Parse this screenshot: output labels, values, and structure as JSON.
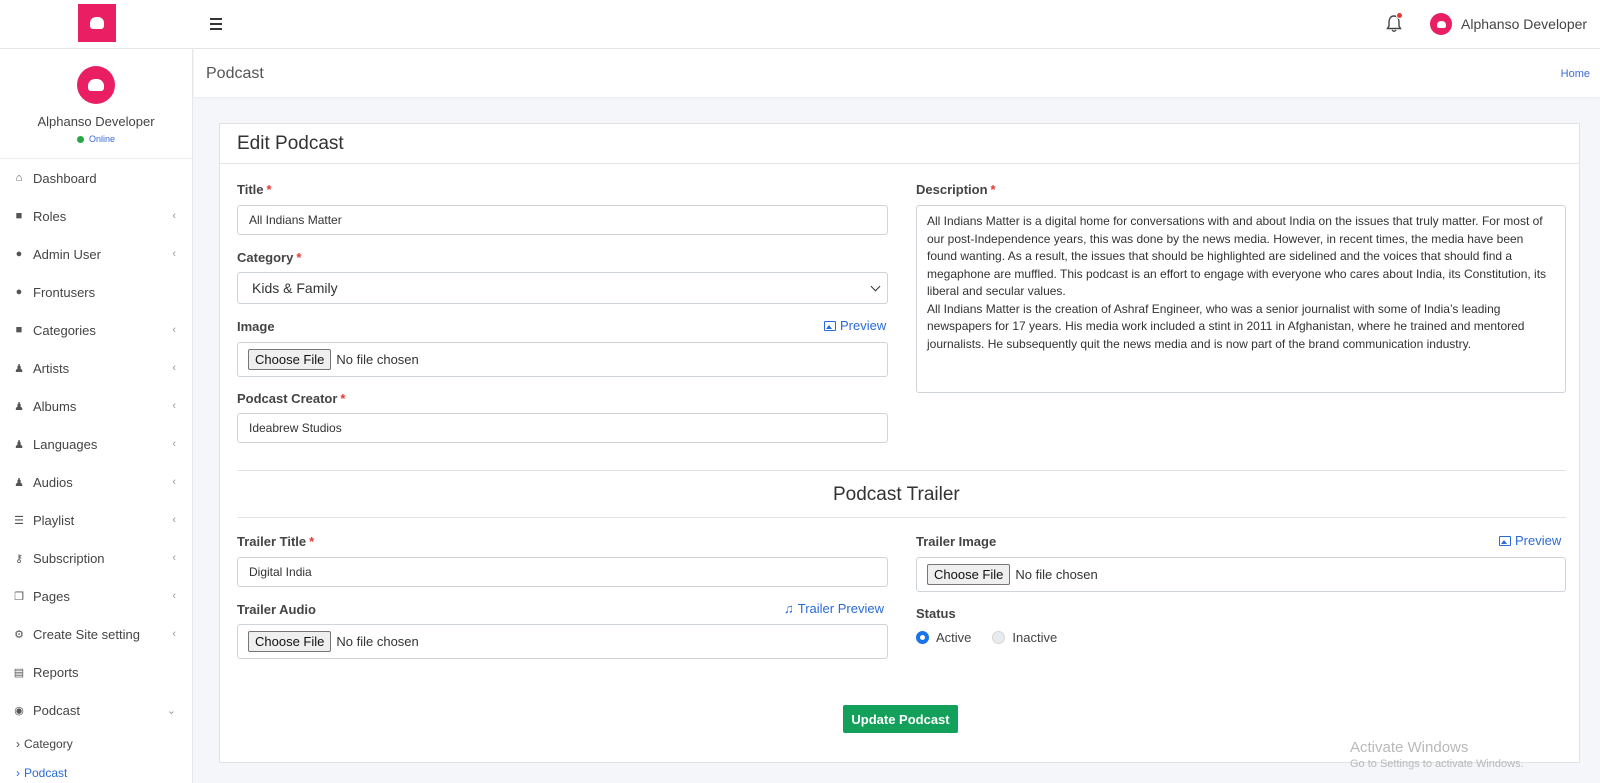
{
  "topbar": {
    "user_name": "Alphanso Developer",
    "icons": [
      "menu-icon",
      "bell-icon"
    ]
  },
  "sidebar": {
    "profile_name": "Alphanso Developer",
    "status": "Online",
    "items": [
      {
        "label": "Dashboard",
        "icon": "home-icon",
        "has_chevron": false
      },
      {
        "label": "Roles",
        "icon": "briefcase-icon",
        "has_chevron": true
      },
      {
        "label": "Admin User",
        "icon": "users-icon",
        "has_chevron": true
      },
      {
        "label": "Frontusers",
        "icon": "users-icon",
        "has_chevron": false
      },
      {
        "label": "Categories",
        "icon": "briefcase-icon",
        "has_chevron": true
      },
      {
        "label": "Artists",
        "icon": "person-icon",
        "has_chevron": true
      },
      {
        "label": "Albums",
        "icon": "person-icon",
        "has_chevron": true
      },
      {
        "label": "Languages",
        "icon": "person-icon",
        "has_chevron": true
      },
      {
        "label": "Audios",
        "icon": "person-icon",
        "has_chevron": true
      },
      {
        "label": "Playlist",
        "icon": "list-icon",
        "has_chevron": true
      },
      {
        "label": "Subscription",
        "icon": "key-icon",
        "has_chevron": true
      },
      {
        "label": "Pages",
        "icon": "copy-icon",
        "has_chevron": true
      },
      {
        "label": "Create Site setting",
        "icon": "gears-icon",
        "has_chevron": true
      },
      {
        "label": "Reports",
        "icon": "file-excel-icon",
        "has_chevron": false
      },
      {
        "label": "Podcast",
        "icon": "podcast-icon",
        "has_chevron": true
      }
    ],
    "submenu": [
      {
        "label": "Category"
      },
      {
        "label": "Podcast"
      }
    ]
  },
  "page_header": {
    "title": "Podcast",
    "breadcrumb": "Home"
  },
  "form": {
    "heading": "Edit Podcast",
    "title_label": "Title",
    "title_value": "All Indians Matter",
    "category_label": "Category",
    "category_value": "Kids & Family",
    "image_label": "Image",
    "preview_label": "Preview",
    "choose_file": "Choose File",
    "no_file": "No file chosen",
    "creator_label": "Podcast Creator",
    "creator_value": "Ideabrew Studios",
    "description_label": "Description",
    "description_p1": "All Indians Matter is a digital home for conversations with and about India on the issues that truly matter. For most of our post-Independence years, this was done by the news media. However, in recent times, the media have been found wanting. As a result, the issues that should be highlighted are sidelined and the voices that should find a megaphone are muffled. This podcast is an effort to engage with everyone who cares about India, its Constitution, its liberal and secular values.",
    "description_p2": "All Indians Matter is the creation of Ashraf Engineer, who was a senior journalist with some of India’s leading newspapers for 17 years. His media work included a stint in 2011 in Afghanistan, where he trained and mentored journalists. He subsequently quit the news media and is now part of the brand communication industry.",
    "trailer_section_title": "Podcast Trailer",
    "trailer_title_label": "Trailer Title",
    "trailer_title_value": "Digital India",
    "trailer_audio_label": "Trailer Audio",
    "trailer_preview_label": "Trailer Preview",
    "trailer_image_label": "Trailer Image",
    "status_label": "Status",
    "status_options": [
      "Active",
      "Inactive"
    ],
    "status_selected": "Active",
    "submit_label": "Update Podcast",
    "required_mark": "*"
  },
  "watermark": {
    "line1": "Activate Windows",
    "line2": "Go to Settings to activate Windows."
  },
  "colors": {
    "brand_pink": "#e91e63",
    "link_blue": "#2b6bd6",
    "submit_green": "#13a05a",
    "required_red": "#e53935"
  }
}
